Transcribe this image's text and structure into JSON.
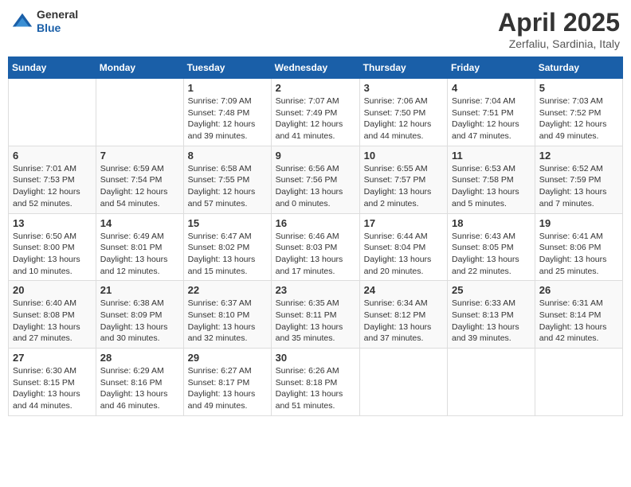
{
  "header": {
    "logo": {
      "general": "General",
      "blue": "Blue"
    },
    "title": "April 2025",
    "location": "Zerfaliu, Sardinia, Italy"
  },
  "calendar": {
    "weekdays": [
      "Sunday",
      "Monday",
      "Tuesday",
      "Wednesday",
      "Thursday",
      "Friday",
      "Saturday"
    ],
    "weeks": [
      [
        {
          "day": "",
          "info": ""
        },
        {
          "day": "",
          "info": ""
        },
        {
          "day": "1",
          "info": "Sunrise: 7:09 AM\nSunset: 7:48 PM\nDaylight: 12 hours and 39 minutes."
        },
        {
          "day": "2",
          "info": "Sunrise: 7:07 AM\nSunset: 7:49 PM\nDaylight: 12 hours and 41 minutes."
        },
        {
          "day": "3",
          "info": "Sunrise: 7:06 AM\nSunset: 7:50 PM\nDaylight: 12 hours and 44 minutes."
        },
        {
          "day": "4",
          "info": "Sunrise: 7:04 AM\nSunset: 7:51 PM\nDaylight: 12 hours and 47 minutes."
        },
        {
          "day": "5",
          "info": "Sunrise: 7:03 AM\nSunset: 7:52 PM\nDaylight: 12 hours and 49 minutes."
        }
      ],
      [
        {
          "day": "6",
          "info": "Sunrise: 7:01 AM\nSunset: 7:53 PM\nDaylight: 12 hours and 52 minutes."
        },
        {
          "day": "7",
          "info": "Sunrise: 6:59 AM\nSunset: 7:54 PM\nDaylight: 12 hours and 54 minutes."
        },
        {
          "day": "8",
          "info": "Sunrise: 6:58 AM\nSunset: 7:55 PM\nDaylight: 12 hours and 57 minutes."
        },
        {
          "day": "9",
          "info": "Sunrise: 6:56 AM\nSunset: 7:56 PM\nDaylight: 13 hours and 0 minutes."
        },
        {
          "day": "10",
          "info": "Sunrise: 6:55 AM\nSunset: 7:57 PM\nDaylight: 13 hours and 2 minutes."
        },
        {
          "day": "11",
          "info": "Sunrise: 6:53 AM\nSunset: 7:58 PM\nDaylight: 13 hours and 5 minutes."
        },
        {
          "day": "12",
          "info": "Sunrise: 6:52 AM\nSunset: 7:59 PM\nDaylight: 13 hours and 7 minutes."
        }
      ],
      [
        {
          "day": "13",
          "info": "Sunrise: 6:50 AM\nSunset: 8:00 PM\nDaylight: 13 hours and 10 minutes."
        },
        {
          "day": "14",
          "info": "Sunrise: 6:49 AM\nSunset: 8:01 PM\nDaylight: 13 hours and 12 minutes."
        },
        {
          "day": "15",
          "info": "Sunrise: 6:47 AM\nSunset: 8:02 PM\nDaylight: 13 hours and 15 minutes."
        },
        {
          "day": "16",
          "info": "Sunrise: 6:46 AM\nSunset: 8:03 PM\nDaylight: 13 hours and 17 minutes."
        },
        {
          "day": "17",
          "info": "Sunrise: 6:44 AM\nSunset: 8:04 PM\nDaylight: 13 hours and 20 minutes."
        },
        {
          "day": "18",
          "info": "Sunrise: 6:43 AM\nSunset: 8:05 PM\nDaylight: 13 hours and 22 minutes."
        },
        {
          "day": "19",
          "info": "Sunrise: 6:41 AM\nSunset: 8:06 PM\nDaylight: 13 hours and 25 minutes."
        }
      ],
      [
        {
          "day": "20",
          "info": "Sunrise: 6:40 AM\nSunset: 8:08 PM\nDaylight: 13 hours and 27 minutes."
        },
        {
          "day": "21",
          "info": "Sunrise: 6:38 AM\nSunset: 8:09 PM\nDaylight: 13 hours and 30 minutes."
        },
        {
          "day": "22",
          "info": "Sunrise: 6:37 AM\nSunset: 8:10 PM\nDaylight: 13 hours and 32 minutes."
        },
        {
          "day": "23",
          "info": "Sunrise: 6:35 AM\nSunset: 8:11 PM\nDaylight: 13 hours and 35 minutes."
        },
        {
          "day": "24",
          "info": "Sunrise: 6:34 AM\nSunset: 8:12 PM\nDaylight: 13 hours and 37 minutes."
        },
        {
          "day": "25",
          "info": "Sunrise: 6:33 AM\nSunset: 8:13 PM\nDaylight: 13 hours and 39 minutes."
        },
        {
          "day": "26",
          "info": "Sunrise: 6:31 AM\nSunset: 8:14 PM\nDaylight: 13 hours and 42 minutes."
        }
      ],
      [
        {
          "day": "27",
          "info": "Sunrise: 6:30 AM\nSunset: 8:15 PM\nDaylight: 13 hours and 44 minutes."
        },
        {
          "day": "28",
          "info": "Sunrise: 6:29 AM\nSunset: 8:16 PM\nDaylight: 13 hours and 46 minutes."
        },
        {
          "day": "29",
          "info": "Sunrise: 6:27 AM\nSunset: 8:17 PM\nDaylight: 13 hours and 49 minutes."
        },
        {
          "day": "30",
          "info": "Sunrise: 6:26 AM\nSunset: 8:18 PM\nDaylight: 13 hours and 51 minutes."
        },
        {
          "day": "",
          "info": ""
        },
        {
          "day": "",
          "info": ""
        },
        {
          "day": "",
          "info": ""
        }
      ]
    ]
  }
}
